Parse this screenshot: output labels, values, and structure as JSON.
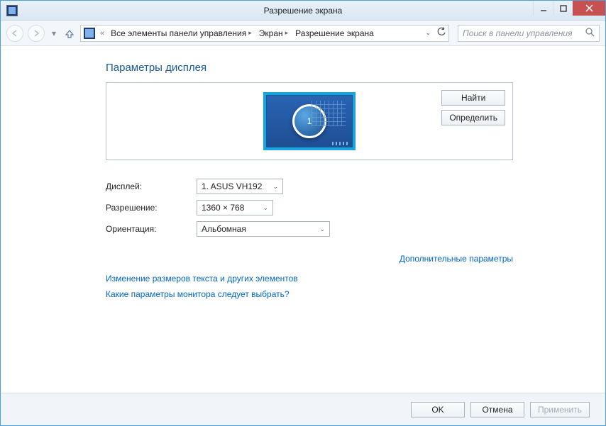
{
  "window": {
    "title": "Разрешение экрана"
  },
  "breadcrumb": {
    "seg1": "Все элементы панели управления",
    "seg2": "Экран",
    "seg3": "Разрешение экрана"
  },
  "search": {
    "placeholder": "Поиск в панели управления"
  },
  "page": {
    "heading": "Параметры дисплея",
    "find": "Найти",
    "identify": "Определить",
    "monitor_number": "1"
  },
  "form": {
    "display_label": "Дисплей:",
    "display_value": "1. ASUS VH192",
    "resolution_label": "Разрешение:",
    "resolution_value": "1360 × 768",
    "orientation_label": "Ориентация:",
    "orientation_value": "Альбомная"
  },
  "links": {
    "advanced": "Дополнительные параметры",
    "resize": "Изменение размеров текста и других элементов",
    "which": "Какие параметры монитора следует выбрать?"
  },
  "footer": {
    "ok": "OK",
    "cancel": "Отмена",
    "apply": "Применить"
  }
}
